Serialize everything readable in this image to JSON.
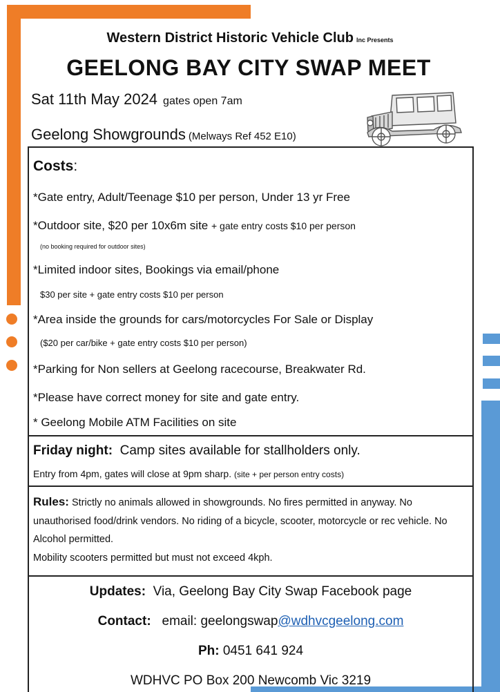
{
  "header": {
    "club": "Western District Historic Vehicle Club",
    "club_suffix": "Inc Presents",
    "title": "GEELONG BAY CITY SWAP MEET",
    "date": "Sat 11th May 2024",
    "gates": "gates open 7am",
    "venue": "Geelong Showgrounds",
    "melways": "(Melways Ref 452 E10)",
    "car_icon": "vintage-car-icon"
  },
  "costs": {
    "heading": "Costs",
    "heading_colon": ":",
    "gate_entry": "*Gate entry, Adult/Teenage $10 per person, Under 13 yr Free",
    "outdoor_main": "*Outdoor site, $20 per 10x6m site",
    "outdoor_extra": "+ gate entry costs $10 per person",
    "outdoor_note": "(no booking required for outdoor sites)",
    "indoor": "*Limited indoor sites, Bookings via email/phone",
    "indoor_note": "$30 per site + gate entry costs $10 per person",
    "area": "*Area inside the grounds for cars/motorcycles For Sale or Display",
    "area_note": "($20 per car/bike + gate entry costs $10 per person)",
    "parking": "*Parking for Non sellers at Geelong racecourse, Breakwater Rd.",
    "money": "*Please have correct money for site and gate entry.",
    "atm": "* Geelong Mobile ATM Facilities on site"
  },
  "friday": {
    "label": "Friday night:",
    "text": "Camp sites available for stallholders only.",
    "sub": "Entry from 4pm, gates will close at 9pm sharp.",
    "sub_note": "(site + per person entry costs)"
  },
  "rules": {
    "label": "Rules:",
    "text": "Strictly no animals allowed in showgrounds. No fires permitted in anyway. No unauthorised food/drink vendors. No riding of a bicycle, scooter, motorcycle or rec vehicle. No Alcohol permitted.",
    "mobility": "Mobility scooters permitted but must not exceed 4kph."
  },
  "contact": {
    "updates_label": "Updates:",
    "updates_text": "Via, Geelong Bay City Swap Facebook page",
    "contact_label": "Contact:",
    "email_prefix": "email: geelongswap",
    "email_link": "@wdhvcgeelong.com",
    "phone_label": "Ph:",
    "phone": "0451 641 924",
    "address": "WDHVC PO Box 200 Newcomb Vic  3219"
  },
  "colors": {
    "accent_orange": "#ef7d27",
    "accent_blue": "#5a9ad6",
    "link": "#1d5fb3"
  }
}
